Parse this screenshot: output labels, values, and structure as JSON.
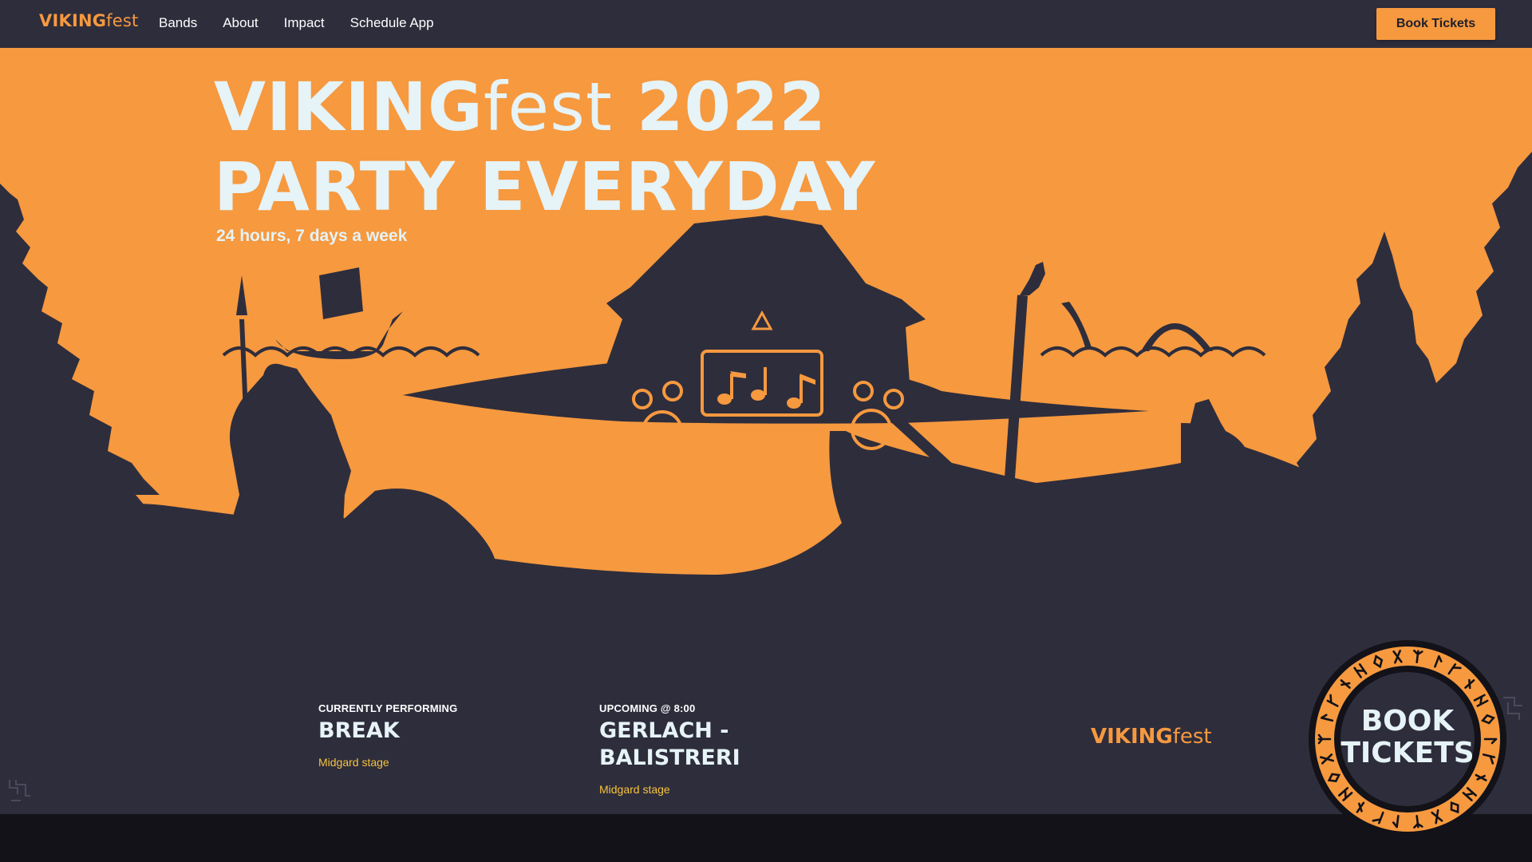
{
  "nav": {
    "logo_bold": "VIKING",
    "logo_light": "fest",
    "links": [
      "Bands",
      "About",
      "Impact",
      "Schedule App"
    ],
    "cta": "Book Tickets"
  },
  "hero": {
    "title_bold": "VIKING",
    "title_light": "fest",
    "title_year": " 2022",
    "title_line2": "PARTY EVERYDAY",
    "subtitle": "24 hours, 7 days a week"
  },
  "status": {
    "current": {
      "label": "CURRENTLY PERFORMING",
      "band": "BREAK",
      "stage": "Midgard stage"
    },
    "upcoming": {
      "label": "UPCOMING @ 8:00",
      "band": "GERLACH - BALISTRERI",
      "stage": "Midgard stage"
    },
    "logo_bold": "VIKING",
    "logo_light": "fest"
  },
  "badge": {
    "line1": "BOOK",
    "line2": "TICKETS"
  },
  "colors": {
    "accent": "#f6993f",
    "navy": "#2e2d3c",
    "text_light": "#e6f3f7",
    "stage_link": "#f6c23e",
    "page_bg": "#121218"
  }
}
